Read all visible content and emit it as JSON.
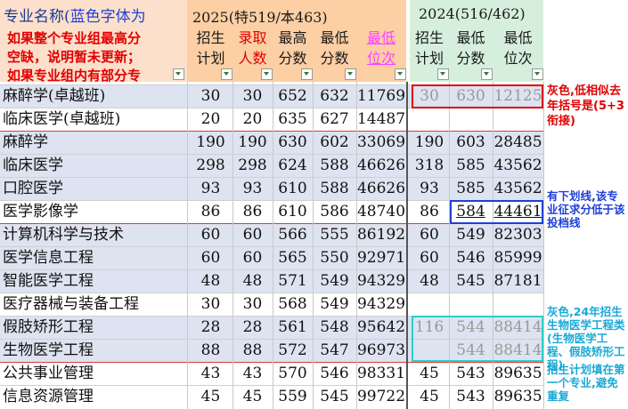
{
  "header": {
    "name_col_title": "专业名称(",
    "name_col_title_blue": "蓝色字体为",
    "name_col_note": [
      "如果整个专业组最高分",
      "空缺，说明暂未更新；",
      "如果专业组内有部分专"
    ],
    "y2025_title": "2025(特519/本463)",
    "y2024_title": "2024(516/462)",
    "cols2025": [
      "招生\n计划",
      "录取\n人数",
      "最高\n分数",
      "最低\n分数",
      "最低\n位次"
    ],
    "cols2024": [
      "招生\n计划",
      "最低\n分数",
      "最低\n位次"
    ]
  },
  "rows": [
    {
      "name": "麻醉学(卓越班)",
      "p25": "30",
      "a25": "30",
      "max25": "652",
      "min25": "632",
      "rank25": "11769",
      "p24": "30",
      "min24": "630",
      "rank24": "12125"
    },
    {
      "name": "临床医学(卓越班)",
      "p25": "20",
      "a25": "20",
      "max25": "635",
      "min25": "627",
      "rank25": "14487",
      "p24": "",
      "min24": "",
      "rank24": ""
    },
    {
      "name": "麻醉学",
      "p25": "190",
      "a25": "190",
      "max25": "630",
      "min25": "602",
      "rank25": "33069",
      "p24": "190",
      "min24": "603",
      "rank24": "28485"
    },
    {
      "name": "临床医学",
      "p25": "298",
      "a25": "298",
      "max25": "624",
      "min25": "588",
      "rank25": "46626",
      "p24": "318",
      "min24": "585",
      "rank24": "43562"
    },
    {
      "name": "口腔医学",
      "p25": "93",
      "a25": "93",
      "max25": "610",
      "min25": "588",
      "rank25": "46626",
      "p24": "93",
      "min24": "585",
      "rank24": "43562"
    },
    {
      "name": "医学影像学",
      "p25": "86",
      "a25": "86",
      "max25": "610",
      "min25": "586",
      "rank25": "48740",
      "p24": "86",
      "min24": "584",
      "rank24": "44461"
    },
    {
      "name": "计算机科学与技术",
      "p25": "60",
      "a25": "60",
      "max25": "566",
      "min25": "555",
      "rank25": "86192",
      "p24": "60",
      "min24": "549",
      "rank24": "82303"
    },
    {
      "name": "医学信息工程",
      "p25": "60",
      "a25": "60",
      "max25": "565",
      "min25": "550",
      "rank25": "92971",
      "p24": "60",
      "min24": "546",
      "rank24": "85999"
    },
    {
      "name": "智能医学工程",
      "p25": "48",
      "a25": "48",
      "max25": "571",
      "min25": "549",
      "rank25": "94329",
      "p24": "48",
      "min24": "545",
      "rank24": "87181"
    },
    {
      "name": "医疗器械与装备工程",
      "p25": "30",
      "a25": "30",
      "max25": "568",
      "min25": "549",
      "rank25": "94329",
      "p24": "",
      "min24": "",
      "rank24": ""
    },
    {
      "name": "假肢矫形工程",
      "p25": "28",
      "a25": "28",
      "max25": "561",
      "min25": "548",
      "rank25": "95642",
      "p24": "116",
      "min24": "544",
      "rank24": "88414"
    },
    {
      "name": "生物医学工程",
      "p25": "88",
      "a25": "88",
      "max25": "572",
      "min25": "547",
      "rank25": "96973",
      "p24": "",
      "min24": "544",
      "rank24": "88414"
    },
    {
      "name": "公共事业管理",
      "p25": "43",
      "a25": "43",
      "max25": "570",
      "min25": "546",
      "rank25": "98331",
      "p24": "45",
      "min24": "543",
      "rank24": "89635"
    },
    {
      "name": "信息资源管理",
      "p25": "45",
      "a25": "45",
      "max25": "559",
      "min25": "545",
      "rank25": "99722",
      "p24": "45",
      "min24": "543",
      "rank24": "89635"
    }
  ],
  "notes": {
    "red": "灰色,低相似去年括号是(5+3衔接)",
    "blue": "有下划线,该专业征求分低于该投档线",
    "cyan1": "灰色,24年招生生物医学工程类(生物医学工程、假肢矫形工程)",
    "cyan2": "招生计划填在第一个专业,避免重复"
  },
  "colors": {
    "peach": "#fccfa4",
    "light_peach": "#fde0cc",
    "green": "#d6efdc",
    "band": "#dde3f0",
    "red": "#e00000",
    "blue": "#1f3fd6",
    "cyan": "#2ad0c8"
  }
}
